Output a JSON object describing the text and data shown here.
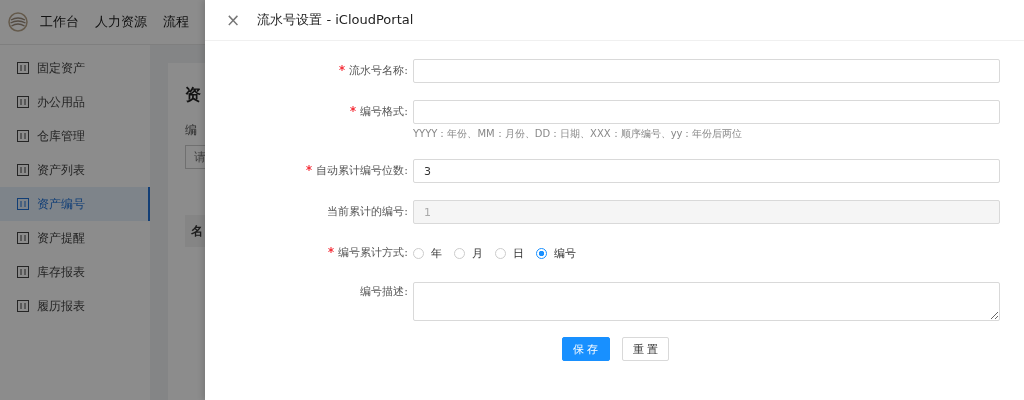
{
  "top_nav": {
    "items": [
      "工作台",
      "人力资源",
      "流程"
    ]
  },
  "sidebar": {
    "items": [
      {
        "label": "固定资产",
        "selected": false
      },
      {
        "label": "办公用品",
        "selected": false
      },
      {
        "label": "仓库管理",
        "selected": false
      },
      {
        "label": "资产列表",
        "selected": false
      },
      {
        "label": "资产编号",
        "selected": true
      },
      {
        "label": "资产提醒",
        "selected": false
      },
      {
        "label": "库存报表",
        "selected": false
      },
      {
        "label": "履历报表",
        "selected": false
      }
    ]
  },
  "card": {
    "title": "资",
    "filter_label": "编",
    "filter_placeholder": "请",
    "table_header": "名"
  },
  "drawer": {
    "close": "×",
    "title": "流水号设置 - iCloudPortal",
    "fields": [
      {
        "kind": "text",
        "required": true,
        "label": "流水号名称:"
      },
      {
        "kind": "text",
        "required": true,
        "label": "编号格式:",
        "hint": "YYYY：年份、MM：月份、DD：日期、XXX：顺序编号、yy：年份后两位"
      },
      {
        "kind": "text",
        "required": true,
        "label": "自动累计编号位数:",
        "value": "3"
      },
      {
        "kind": "disabled",
        "required": false,
        "label": "当前累计的编号:",
        "value": "1"
      },
      {
        "kind": "radio",
        "required": true,
        "label": "编号累计方式:",
        "options": [
          {
            "label": "年",
            "selected": false
          },
          {
            "label": "月",
            "selected": false
          },
          {
            "label": "日",
            "selected": false
          },
          {
            "label": "编号",
            "selected": true
          }
        ]
      },
      {
        "kind": "textarea",
        "required": false,
        "label": "编号描述:"
      }
    ],
    "buttons": [
      {
        "label": "保 存",
        "kind": "primary"
      },
      {
        "label": "重 置",
        "kind": "default"
      }
    ]
  }
}
